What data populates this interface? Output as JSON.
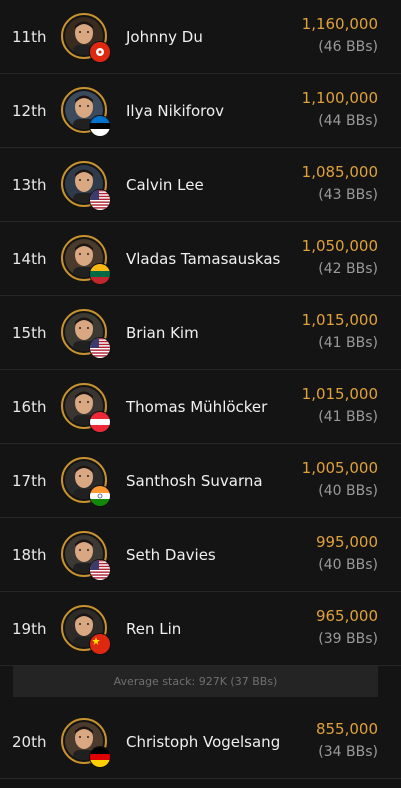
{
  "players": [
    {
      "rank": "11th",
      "name": "Johnny Du",
      "chips": "1,160,000",
      "bbs": "(46 BBs)",
      "flag": "hk",
      "avatar_bg": "#3a2b20"
    },
    {
      "rank": "12th",
      "name": "Ilya Nikiforov",
      "chips": "1,100,000",
      "bbs": "(44 BBs)",
      "flag": "ee",
      "avatar_bg": "#3b4a5c"
    },
    {
      "rank": "13th",
      "name": "Calvin Lee",
      "chips": "1,085,000",
      "bbs": "(43 BBs)",
      "flag": "us",
      "avatar_bg": "#2f3a4a"
    },
    {
      "rank": "14th",
      "name": "Vladas Tamasauskas",
      "chips": "1,050,000",
      "bbs": "(42 BBs)",
      "flag": "lt",
      "avatar_bg": "#4a3a2c"
    },
    {
      "rank": "15th",
      "name": "Brian Kim",
      "chips": "1,015,000",
      "bbs": "(41 BBs)",
      "flag": "us",
      "avatar_bg": "#3b3a33"
    },
    {
      "rank": "16th",
      "name": "Thomas Mühlöcker",
      "chips": "1,015,000",
      "bbs": "(41 BBs)",
      "flag": "at",
      "avatar_bg": "#3a3530"
    },
    {
      "rank": "17th",
      "name": "Santhosh Suvarna",
      "chips": "1,005,000",
      "bbs": "(40 BBs)",
      "flag": "in",
      "avatar_bg": "#2b2a2a"
    },
    {
      "rank": "18th",
      "name": "Seth Davies",
      "chips": "995,000",
      "bbs": "(40 BBs)",
      "flag": "us",
      "avatar_bg": "#3c3833"
    },
    {
      "rank": "19th",
      "name": "Ren Lin",
      "chips": "965,000",
      "bbs": "(39 BBs)",
      "flag": "cn",
      "avatar_bg": "#2e2a28"
    }
  ],
  "average": {
    "label": "Average stack: 927K (37 BBs)"
  },
  "players_after": [
    {
      "rank": "20th",
      "name": "Christoph Vogelsang",
      "chips": "855,000",
      "bbs": "(34 BBs)",
      "flag": "de",
      "avatar_bg": "#4a3b2c"
    }
  ],
  "colors": {
    "accent": "#e0a13b",
    "avatar_ring": "#c8922e",
    "background": "#141414"
  }
}
